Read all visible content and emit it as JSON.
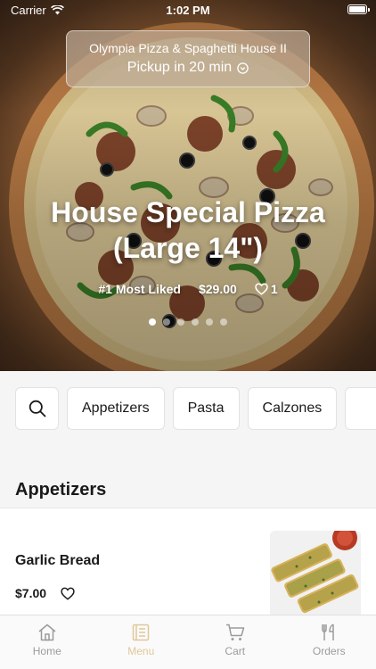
{
  "status": {
    "carrier": "Carrier",
    "time": "1:02 PM"
  },
  "store": {
    "name": "Olympia Pizza & Spaghetti House II",
    "pickup": "Pickup in 20 min"
  },
  "hero": {
    "title_line1": "House Special Pizza",
    "title_line2": "(Large 14\")",
    "badge": "#1 Most Liked",
    "price": "$29.00",
    "likes": "1",
    "dots_total": 6,
    "dots_active": 0
  },
  "categories": {
    "items": [
      "Appetizers",
      "Pasta",
      "Calzones"
    ]
  },
  "section": {
    "title": "Appetizers"
  },
  "menu_item": {
    "name": "Garlic Bread",
    "price": "$7.00"
  },
  "tabs": [
    {
      "label": "Home",
      "icon": "home-icon"
    },
    {
      "label": "Menu",
      "icon": "menu-icon"
    },
    {
      "label": "Cart",
      "icon": "cart-icon"
    },
    {
      "label": "Orders",
      "icon": "orders-icon"
    }
  ],
  "colors": {
    "accent": "#e0c79a",
    "inactive": "#9b9b9b",
    "background": "#f5f5f5"
  }
}
